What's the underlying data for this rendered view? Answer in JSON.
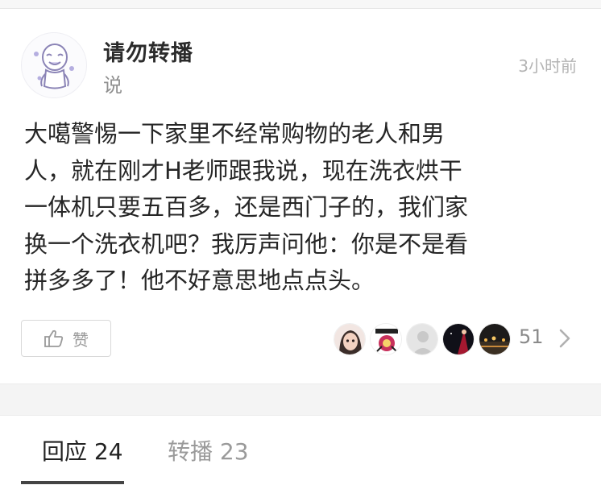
{
  "status": {
    "author_name": "请勿转播",
    "action_label": "说",
    "time": "3小时前",
    "text_lines": [
      "大噶警惕一下家里不经常购物的老人和男",
      "人，就在刚才H老师跟我说，现在洗衣烘干",
      "一体机只要五百多，还是西门子的，我们家",
      "换一个洗衣机吧？我厉声问他：你是不是看",
      "拼多多了！他不好意思地点点头。"
    ]
  },
  "actions": {
    "like_label": "赞",
    "like_count": "51"
  },
  "tabs": {
    "reply_label": "回应 24",
    "repost_label": "转播 23"
  },
  "colors": {
    "text": "#262626",
    "muted": "#8f8f8f",
    "border": "#d9d9d9",
    "band": "#f4f4f4"
  },
  "icons": [
    "meme-avatar",
    "thumbs-up-icon",
    "chevron-right-icon"
  ]
}
